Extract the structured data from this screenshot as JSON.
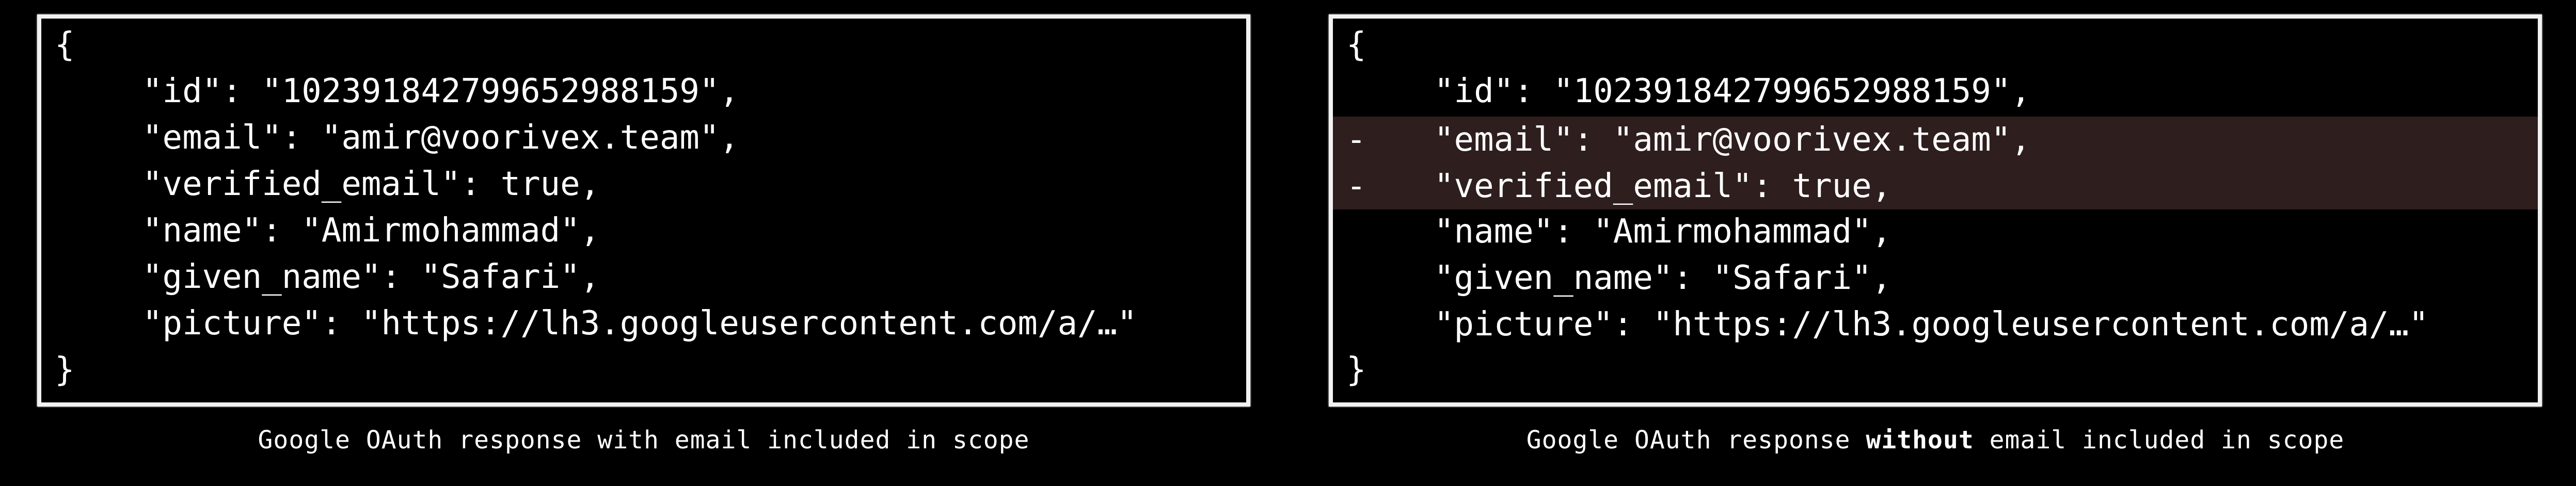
{
  "left": {
    "open_brace": "{",
    "close_brace": "}",
    "lines": [
      "\"id\": \"102391842799652988159\",",
      "\"email\": \"amir@voorivex.team\",",
      "\"verified_email\": true,",
      "\"name\": \"Amirmohammad\",",
      "\"given_name\": \"Safari\",",
      "\"picture\": \"https://lh3.googleusercontent.com/a/…\""
    ],
    "caption": "Google OAuth response with email included in scope"
  },
  "right": {
    "open_brace": "{",
    "close_brace": "}",
    "removed_marker": "-",
    "lines": [
      "\"id\": \"102391842799652988159\",",
      "\"email\": \"amir@voorivex.team\",",
      "\"verified_email\": true,",
      "\"name\": \"Amirmohammad\",",
      "\"given_name\": \"Safari\",",
      "\"picture\": \"https://lh3.googleusercontent.com/a/…\""
    ],
    "removed_line_indices": [
      1,
      2
    ],
    "caption_before": "Google OAuth response ",
    "caption_bold": "without",
    "caption_after": " email included in scope"
  },
  "colors": {
    "background": "#000000",
    "text": "#ffffff",
    "border": "#f2f2f2",
    "removed_highlight": "#2e1e1e"
  }
}
